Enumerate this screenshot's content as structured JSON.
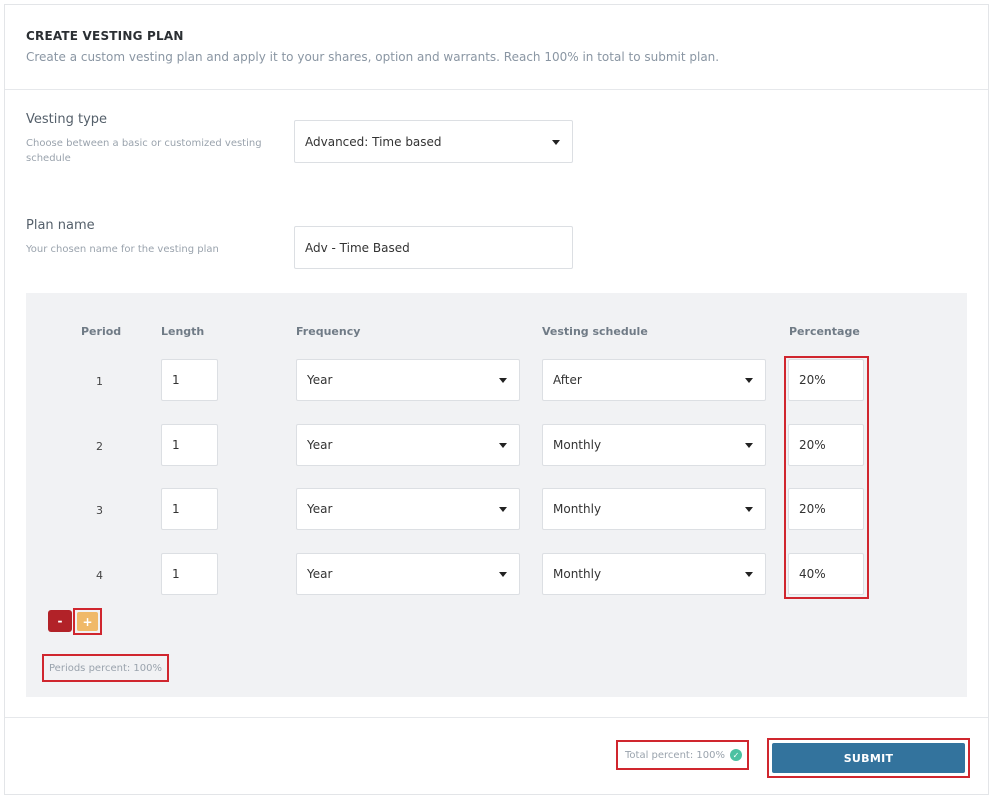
{
  "header": {
    "title": "CREATE VESTING PLAN",
    "subtitle": "Create a custom vesting plan and apply it to your shares, option and warrants. Reach 100% in total to submit plan."
  },
  "vesting_type": {
    "label": "Vesting type",
    "help": "Choose between a basic or customized vesting schedule",
    "value": "Advanced: Time based"
  },
  "plan_name": {
    "label": "Plan name",
    "help": "Your chosen name for the vesting plan",
    "value": "Adv - Time Based"
  },
  "table": {
    "headers": [
      "Period",
      "Length",
      "Frequency",
      "Vesting schedule",
      "Percentage"
    ],
    "rows": [
      {
        "period": "1",
        "length": "1",
        "frequency": "Year",
        "schedule": "After",
        "percentage": "20%"
      },
      {
        "period": "2",
        "length": "1",
        "frequency": "Year",
        "schedule": "Monthly",
        "percentage": "20%"
      },
      {
        "period": "3",
        "length": "1",
        "frequency": "Year",
        "schedule": "Monthly",
        "percentage": "20%"
      },
      {
        "period": "4",
        "length": "1",
        "frequency": "Year",
        "schedule": "Monthly",
        "percentage": "40%"
      }
    ],
    "remove_label": "-",
    "add_label": "+",
    "periods_percent": "Periods percent: 100%"
  },
  "footer": {
    "total_percent": "Total percent: 100%",
    "submit_label": "SUBMIT"
  },
  "colors": {
    "accent": "#33739d",
    "highlight": "#d0262e",
    "remove": "#b22228",
    "add": "#f0b969",
    "success": "#4cc1a2"
  }
}
